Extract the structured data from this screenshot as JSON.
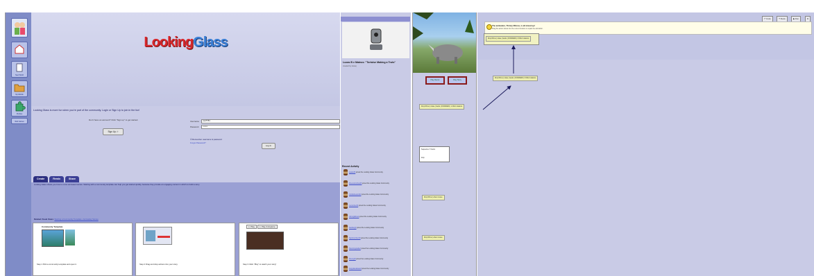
{
  "looking_glass": {
    "rail": [
      "",
      "New World",
      "My Worlds",
      "Puzzles",
      "Web Games"
    ],
    "logo_left": "Looking",
    "logo_right": "Glass",
    "intro": "Looking Glass is more fun when you're part of the community. Login or Sign Up to join in the fun!",
    "no_account": "Don't have an account? Click \"Sign up\" to get started.",
    "sign_up": "Sign Up",
    "username_label": "Username",
    "username_value": "user5781",
    "password_label": "Password",
    "password_value": "••••••••",
    "login": "Log In",
    "remember": "Remember username & password",
    "forgot": "Forgot Password?",
    "tabs": [
      "Create",
      "Remix",
      "Share"
    ],
    "tab_text": "Looking Glass shows you how to remix animated stories. Starting with a community template can help you get started quickly, because they provide an engaging context in which to build a story.",
    "related_label": "Related Visual Views:",
    "related_links": "Starting a Community Template • Animating Stories",
    "steps": [
      {
        "title": "Community Template",
        "caption": "Step 1 Pick a community template and open it."
      },
      {
        "title": "",
        "caption": "Step 2 Drag and drop actions into your story."
      },
      {
        "title": "",
        "caption": "Step 3 Click \"Play\" to watch your story!"
      }
    ],
    "step3_play": "Play",
    "step3_explore": "Play & Explore"
  },
  "sidebar_right": {
    "title": "Lucas B e Mateus: \"Tortoise Making a Truts\"",
    "by": "created by lucasj",
    "recent": "Recent Activity",
    "activity": [
      {
        "user": "ayaan26",
        "text": "joined the Looking Glass Community"
      },
      {
        "user": "kheenanoshea26",
        "text": "joined the Looking Glass Community"
      },
      {
        "user": "mirabaheanra02",
        "text": "joined the Looking Glass Community"
      },
      {
        "user": "cucumber22",
        "text": "joined the Looking Glass Community"
      },
      {
        "user": "ohmoglabnek",
        "text": "joined the Looking Glass Community"
      },
      {
        "user": "bashang3",
        "text": "joined the Looking Glass Community"
      },
      {
        "user": "bspinnumber19",
        "text": "joined the Looking Glass Community"
      },
      {
        "user": "bloomingcadie2",
        "text": "joined the Looking Glass Community"
      },
      {
        "user": "Drumy20",
        "text": "joined the Looking Glass Community"
      },
      {
        "user": "loopydanabana3",
        "text": "joined the Looking Glass Community"
      }
    ]
  },
  "editor": {
    "play_remix": "Play Remix",
    "play_story": "Play Story",
    "tile_row": [
      "Drop Rhino",
      "rotate",
      "backs",
      "FORWARD",
      "1.3012 rotations"
    ],
    "tile_rhino": "Drop Rhino",
    "tile_rhino_sub": "when mouse",
    "box_label": "Sequence",
    "box_label2": "Items",
    "box_sub": "loop"
  },
  "tutorial": {
    "toolbar": [
      "Undo",
      "Redo",
      "Run",
      "X"
    ],
    "message_title": "The animation, Thirsty Rhinos, is all mixed up!",
    "message_sub": "Drag the action below into the correct location to repair the animation.",
    "area_tiles": [
      "Drop Rhino",
      "rotate",
      "backs",
      "FORWARD",
      "0.5012 rotations"
    ],
    "drag_tiles": [
      "Drop Rhino",
      "rotate",
      "backs",
      "FORWARD",
      "0.5012 rotations"
    ]
  }
}
